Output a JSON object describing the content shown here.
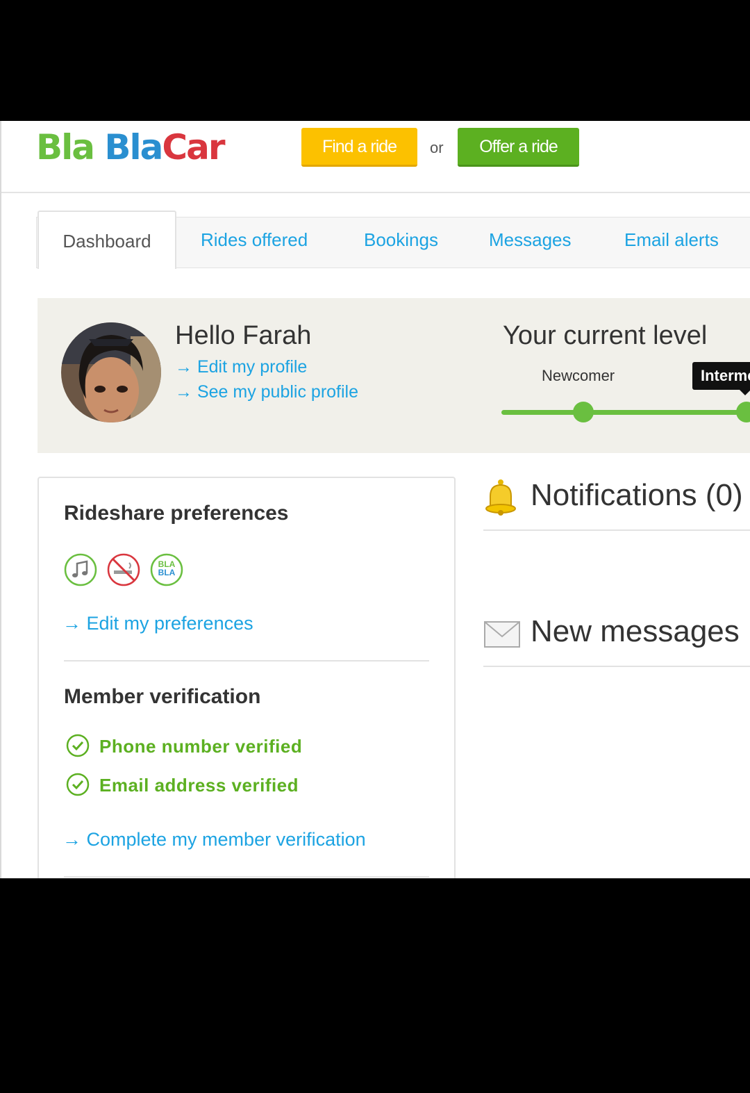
{
  "header": {
    "logo": {
      "w1": "Bla",
      "w2": "Bla",
      "w3": "Car"
    },
    "find_ride": "Find a ride",
    "or_text": "or",
    "offer_ride": "Offer a ride"
  },
  "tabs": [
    "Dashboard",
    "Rides offered",
    "Bookings",
    "Messages",
    "Email alerts"
  ],
  "profile": {
    "greeting": "Hello Farah",
    "edit_profile": "→ Edit my profile",
    "public_profile": "→ See my public profile"
  },
  "level": {
    "title": "Your current level",
    "newcomer": "Newcomer",
    "current_badge": "Interme",
    "icon": "progress-track"
  },
  "preferences": {
    "title": "Rideshare preferences",
    "icons": [
      "music-icon",
      "no-smoking-icon",
      "blabla-icon"
    ],
    "blabla_text": "BLA",
    "edit_link": "→ Edit my preferences"
  },
  "verification": {
    "title": "Member verification",
    "items": [
      "Phone number verified",
      "Email address verified"
    ],
    "complete_link": "→ Complete my member verification"
  },
  "notifications": {
    "title": "Notifications (0)"
  },
  "messages": {
    "title": "New messages"
  },
  "colors": {
    "green": "#6abf40",
    "blue": "#1ca3e2",
    "yellow": "#fcc100",
    "panel": "#f1f0ea"
  }
}
